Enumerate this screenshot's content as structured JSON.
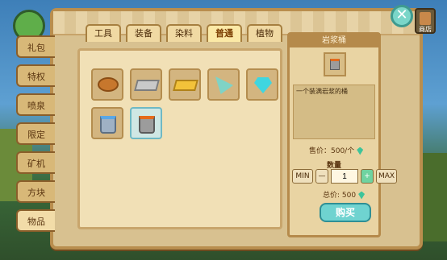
{
  "side_tabs": [
    "礼包",
    "特权",
    "喷泉",
    "限定",
    "矿机",
    "方块",
    "物品"
  ],
  "category_tabs": [
    "工具",
    "装备",
    "染料",
    "普通",
    "植物"
  ],
  "active_tab": "普通",
  "items": [
    {
      "name": "bread-icon"
    },
    {
      "name": "iron-ingot-icon"
    },
    {
      "name": "gold-ingot-icon"
    },
    {
      "name": "arrow-icon"
    },
    {
      "name": "diamond-icon"
    },
    {
      "name": "water-bucket-icon"
    },
    {
      "name": "lava-bucket-icon",
      "selected": true
    }
  ],
  "info": {
    "title": "岩浆桶",
    "description": "一个装满岩浆的桶",
    "price_label": "售价：500/个",
    "quantity_label": "数量",
    "min_label": "MIN",
    "max_label": "MAX",
    "minus": "—",
    "plus": "+",
    "quantity_value": "1",
    "total_label": "总价: 500",
    "buy_label": "购买"
  },
  "shop_label": "商店",
  "colors": {
    "accent": "#6fd3d0",
    "panel": "#d8c190",
    "gem": "#3ec49a"
  }
}
